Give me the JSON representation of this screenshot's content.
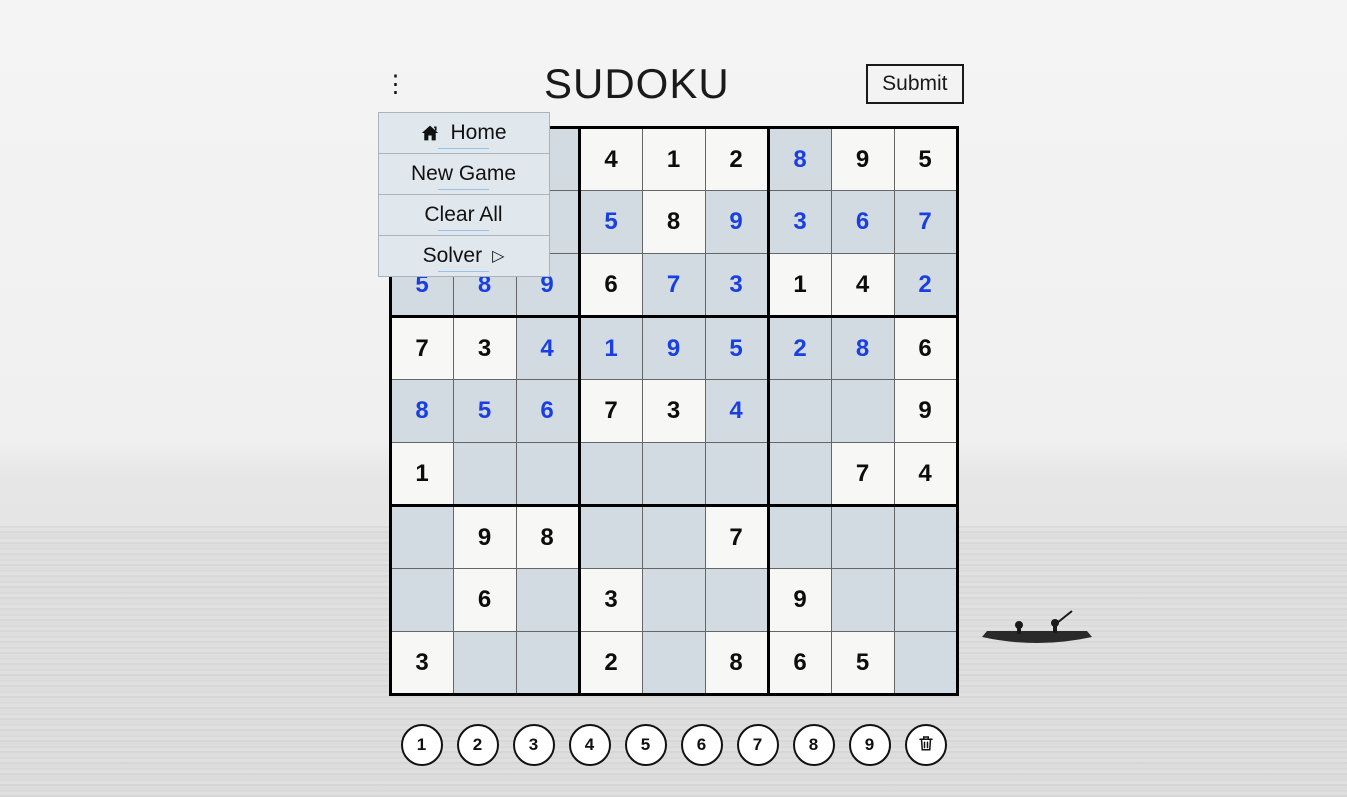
{
  "header": {
    "title": "SUDOKU",
    "submit_label": "Submit"
  },
  "menu": {
    "home_label": "Home",
    "new_game_label": "New Game",
    "clear_all_label": "Clear All",
    "solver_label": "Solver",
    "solver_arrow": "▷"
  },
  "numpad": {
    "n1": "1",
    "n2": "2",
    "n3": "3",
    "n4": "4",
    "n5": "5",
    "n6": "6",
    "n7": "7",
    "n8": "8",
    "n9": "9"
  },
  "grid": [
    [
      {
        "v": "",
        "t": "blank"
      },
      {
        "v": "",
        "t": "blank"
      },
      {
        "v": "",
        "t": "blank"
      },
      {
        "v": "4",
        "t": "given"
      },
      {
        "v": "1",
        "t": "given"
      },
      {
        "v": "2",
        "t": "given"
      },
      {
        "v": "8",
        "t": "user"
      },
      {
        "v": "9",
        "t": "given"
      },
      {
        "v": "5",
        "t": "given"
      }
    ],
    [
      {
        "v": "",
        "t": "blank"
      },
      {
        "v": "",
        "t": "blank"
      },
      {
        "v": "",
        "t": "blank"
      },
      {
        "v": "5",
        "t": "user"
      },
      {
        "v": "8",
        "t": "given"
      },
      {
        "v": "9",
        "t": "user"
      },
      {
        "v": "3",
        "t": "user"
      },
      {
        "v": "6",
        "t": "user"
      },
      {
        "v": "7",
        "t": "user"
      }
    ],
    [
      {
        "v": "5",
        "t": "user"
      },
      {
        "v": "8",
        "t": "user"
      },
      {
        "v": "9",
        "t": "user"
      },
      {
        "v": "6",
        "t": "given"
      },
      {
        "v": "7",
        "t": "user"
      },
      {
        "v": "3",
        "t": "user"
      },
      {
        "v": "1",
        "t": "given"
      },
      {
        "v": "4",
        "t": "given"
      },
      {
        "v": "2",
        "t": "user"
      }
    ],
    [
      {
        "v": "7",
        "t": "given"
      },
      {
        "v": "3",
        "t": "given"
      },
      {
        "v": "4",
        "t": "user"
      },
      {
        "v": "1",
        "t": "user"
      },
      {
        "v": "9",
        "t": "user"
      },
      {
        "v": "5",
        "t": "user"
      },
      {
        "v": "2",
        "t": "user"
      },
      {
        "v": "8",
        "t": "user"
      },
      {
        "v": "6",
        "t": "given"
      }
    ],
    [
      {
        "v": "8",
        "t": "user"
      },
      {
        "v": "5",
        "t": "user"
      },
      {
        "v": "6",
        "t": "user"
      },
      {
        "v": "7",
        "t": "given"
      },
      {
        "v": "3",
        "t": "given"
      },
      {
        "v": "4",
        "t": "user"
      },
      {
        "v": "",
        "t": "blank"
      },
      {
        "v": "",
        "t": "blank"
      },
      {
        "v": "9",
        "t": "given"
      }
    ],
    [
      {
        "v": "1",
        "t": "given"
      },
      {
        "v": "",
        "t": "blank"
      },
      {
        "v": "",
        "t": "blank"
      },
      {
        "v": "",
        "t": "blank"
      },
      {
        "v": "",
        "t": "blank"
      },
      {
        "v": "",
        "t": "blank"
      },
      {
        "v": "",
        "t": "blank"
      },
      {
        "v": "7",
        "t": "given"
      },
      {
        "v": "4",
        "t": "given"
      }
    ],
    [
      {
        "v": "",
        "t": "blank"
      },
      {
        "v": "9",
        "t": "given"
      },
      {
        "v": "8",
        "t": "given"
      },
      {
        "v": "",
        "t": "blank"
      },
      {
        "v": "",
        "t": "blank"
      },
      {
        "v": "7",
        "t": "given"
      },
      {
        "v": "",
        "t": "blank"
      },
      {
        "v": "",
        "t": "blank"
      },
      {
        "v": "",
        "t": "blank"
      }
    ],
    [
      {
        "v": "",
        "t": "blank"
      },
      {
        "v": "6",
        "t": "given"
      },
      {
        "v": "",
        "t": "blank"
      },
      {
        "v": "3",
        "t": "given"
      },
      {
        "v": "",
        "t": "blank"
      },
      {
        "v": "",
        "t": "blank"
      },
      {
        "v": "9",
        "t": "given"
      },
      {
        "v": "",
        "t": "blank"
      },
      {
        "v": "",
        "t": "blank"
      }
    ],
    [
      {
        "v": "3",
        "t": "given"
      },
      {
        "v": "",
        "t": "blank"
      },
      {
        "v": "",
        "t": "blank"
      },
      {
        "v": "2",
        "t": "given"
      },
      {
        "v": "",
        "t": "blank"
      },
      {
        "v": "8",
        "t": "given"
      },
      {
        "v": "6",
        "t": "given"
      },
      {
        "v": "5",
        "t": "given"
      },
      {
        "v": "",
        "t": "blank"
      }
    ]
  ]
}
